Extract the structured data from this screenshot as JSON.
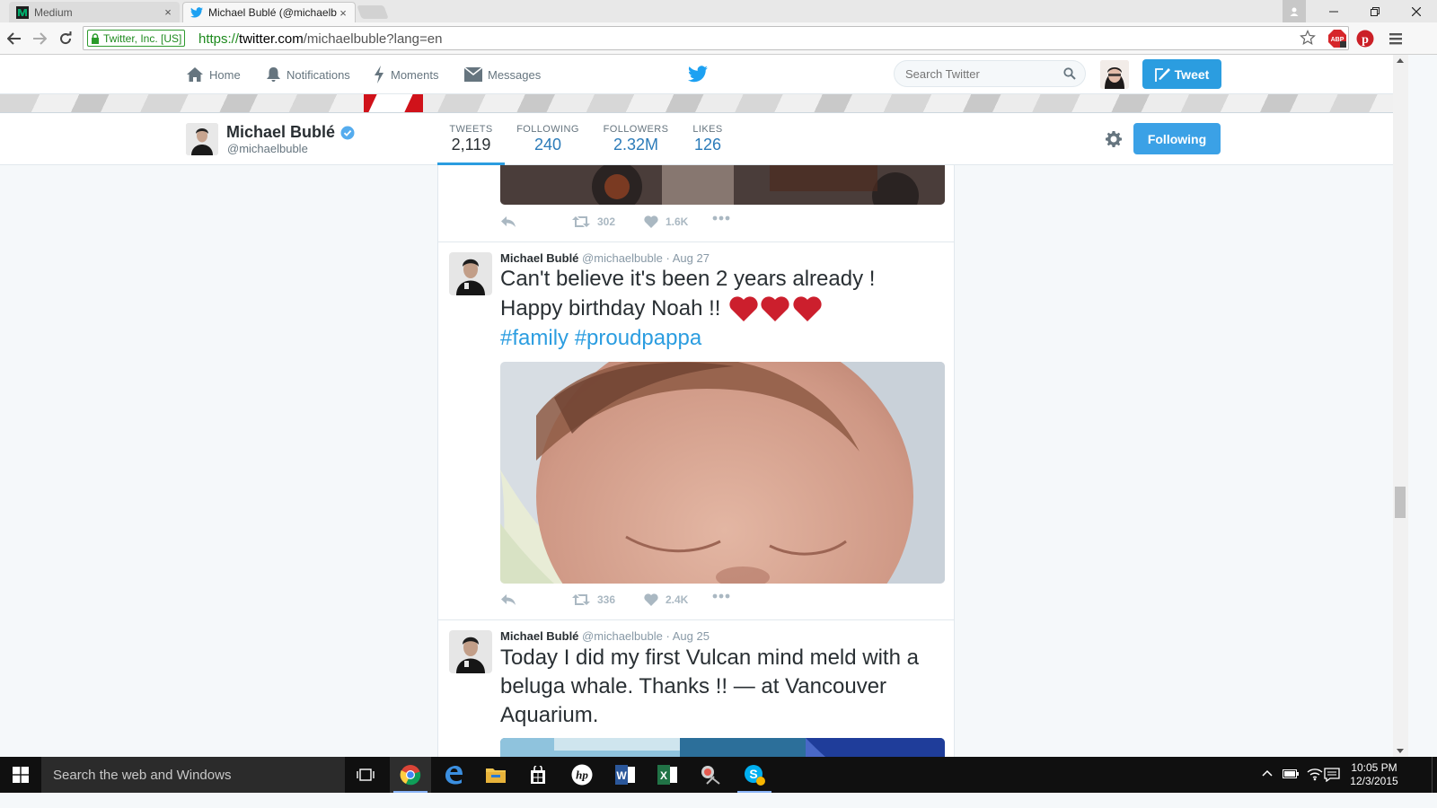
{
  "browser": {
    "tabs": [
      {
        "title": "Medium",
        "close": "×"
      },
      {
        "title": "Michael Bublé (@michaelb",
        "close": "×"
      }
    ],
    "ev_label": "Twitter, Inc. [US]",
    "url": {
      "protocol": "https://",
      "host": "twitter.com",
      "path": "/michaelbuble?lang=en"
    },
    "extensions": [
      "adblock-icon",
      "pinterest-icon",
      "chrome-menu-icon"
    ]
  },
  "twitter_nav": {
    "items": [
      {
        "label": "Home",
        "icon": "home-icon"
      },
      {
        "label": "Notifications",
        "icon": "bell-icon"
      },
      {
        "label": "Moments",
        "icon": "lightning-icon"
      },
      {
        "label": "Messages",
        "icon": "envelope-icon"
      }
    ],
    "search_placeholder": "Search Twitter",
    "tweet_button": "Tweet",
    "brand_color": "#1da1f2"
  },
  "profile": {
    "name": "Michael Bublé",
    "handle": "@michaelbuble",
    "verified": true,
    "stats": [
      {
        "label": "TWEETS",
        "value": "2,119",
        "active": true
      },
      {
        "label": "FOLLOWING",
        "value": "240",
        "active": false
      },
      {
        "label": "FOLLOWERS",
        "value": "2.32M",
        "active": false
      },
      {
        "label": "LIKES",
        "value": "126",
        "active": false
      }
    ],
    "follow_button": "Following"
  },
  "tweets": [
    {
      "partial": true,
      "retweets": "302",
      "likes": "1.6K"
    },
    {
      "name": "Michael Bublé",
      "handle": "@michaelbuble",
      "sep": "·",
      "date": "Aug 27",
      "text_line1": "Can't believe it's been 2 years already !",
      "text_line2": "Happy birthday Noah !!",
      "hashtags": [
        "#family",
        "#proudpappa"
      ],
      "retweets": "336",
      "likes": "2.4K"
    },
    {
      "name": "Michael Bublé",
      "handle": "@michaelbuble",
      "sep": "·",
      "date": "Aug 25",
      "text": "Today I did my first Vulcan mind meld with a beluga whale. Thanks !! — at Vancouver Aquarium."
    }
  ],
  "taskbar": {
    "search_placeholder": "Search the web and Windows",
    "apps": [
      "task-view-icon",
      "chrome-icon",
      "edge-icon",
      "file-explorer-icon",
      "store-icon",
      "hp-icon",
      "word-icon",
      "excel-icon",
      "snipping-tool-icon",
      "skype-icon"
    ],
    "time": "10:05 PM",
    "date": "12/3/2015"
  }
}
